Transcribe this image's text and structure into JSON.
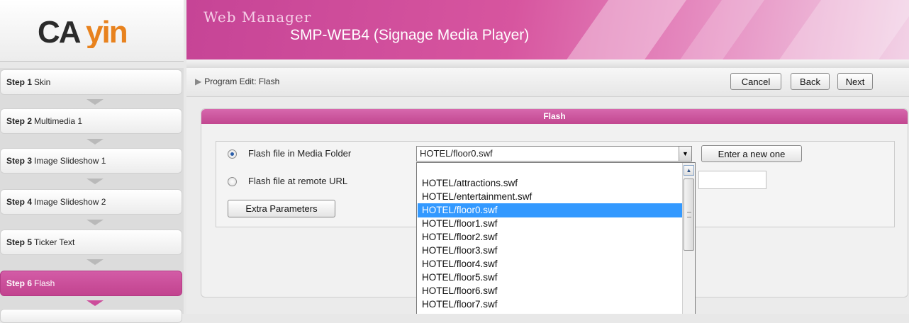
{
  "header": {
    "logo_text": "CAYIN",
    "app_name": "Web Manager",
    "product": "SMP-WEB4 (Signage Media Player)"
  },
  "sidebar": {
    "steps": [
      {
        "num": "Step 1",
        "label": "Skin"
      },
      {
        "num": "Step 2",
        "label": "Multimedia 1"
      },
      {
        "num": "Step 3",
        "label": "Image Slideshow 1"
      },
      {
        "num": "Step 4",
        "label": "Image Slideshow 2"
      },
      {
        "num": "Step 5",
        "label": "Ticker Text"
      },
      {
        "num": "Step 6",
        "label": "Flash"
      }
    ]
  },
  "toolbar": {
    "page_title": "Program Edit: Flash",
    "cancel_label": "Cancel",
    "back_label": "Back",
    "next_label": "Next"
  },
  "panel": {
    "heading": "Flash",
    "option_media_label": "Flash file in Media Folder",
    "option_remote_label": "Flash file at remote URL",
    "extra_params_label": "Extra Parameters",
    "enter_new_label": "Enter a new one",
    "selected_file": "HOTEL/floor0.swf",
    "remote_url_value": ""
  },
  "dropdown": {
    "options": [
      "",
      "HOTEL/attractions.swf",
      "HOTEL/entertainment.swf",
      "HOTEL/floor0.swf",
      "HOTEL/floor1.swf",
      "HOTEL/floor2.swf",
      "HOTEL/floor3.swf",
      "HOTEL/floor4.swf",
      "HOTEL/floor5.swf",
      "HOTEL/floor6.swf",
      "HOTEL/floor7.swf"
    ],
    "highlighted": "HOTEL/floor0.swf"
  },
  "colors": {
    "brand_pink": "#c64496",
    "selection_blue": "#3399ff",
    "logo_orange": "#e8821e"
  }
}
